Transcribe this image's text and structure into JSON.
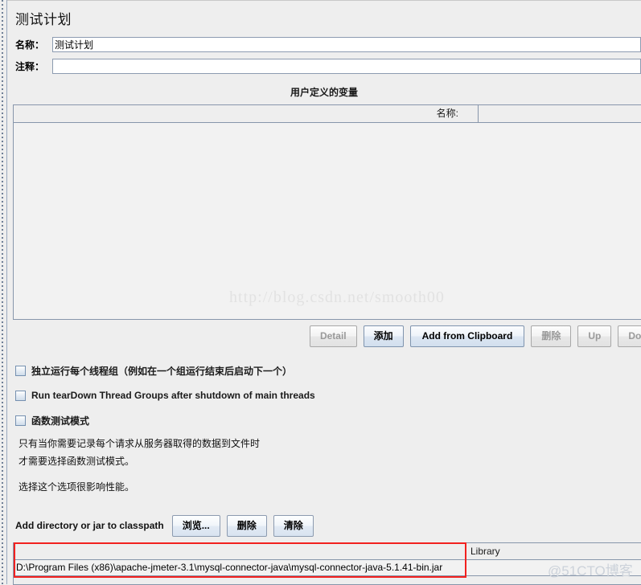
{
  "window": {
    "title": "测试计划"
  },
  "fields": {
    "name_label": "名称：",
    "name_value": "测试计划",
    "comment_label": "注释：",
    "comment_value": ""
  },
  "user_defined_variables": {
    "caption": "用户定义的变量",
    "columns": [
      "名称:",
      ""
    ],
    "rows": [],
    "buttons": [
      {
        "label": "Detail",
        "enabled": false
      },
      {
        "label": "添加",
        "enabled": true
      },
      {
        "label": "Add from Clipboard",
        "enabled": true
      },
      {
        "label": "删除",
        "enabled": false
      },
      {
        "label": "Up",
        "enabled": false
      },
      {
        "label": "Down",
        "enabled": false
      }
    ]
  },
  "options": [
    {
      "label": "独立运行每个线程组（例如在一个组运行结束后启动下一个）",
      "checked": false
    },
    {
      "label": "Run tearDown Thread Groups after shutdown of main threads",
      "checked": false
    },
    {
      "label": "函数测试模式",
      "checked": false
    }
  ],
  "description": {
    "line1": "只有当你需要记录每个请求从服务器取得的数据到文件时",
    "line2": "才需要选择函数测试模式。",
    "line3": "选择这个选项很影响性能。"
  },
  "classpath": {
    "label": "Add directory or jar to classpath",
    "buttons": [
      {
        "label": "浏览...",
        "name": "browse"
      },
      {
        "label": "删除",
        "name": "delete"
      },
      {
        "label": "清除",
        "name": "clear"
      }
    ],
    "columns": [
      "",
      "Library"
    ],
    "rows": [
      {
        "path": "D:\\Program Files (x86)\\apache-jmeter-3.1\\mysql-connector-java\\mysql-connector-java-5.1.41-bin.jar",
        "library": ""
      }
    ]
  },
  "watermarks": {
    "center": "http://blog.csdn.net/smooth00",
    "bottom_right": "@51CTO博客"
  },
  "colors": {
    "background": "#eeeeee",
    "panel_border": "#8796ab",
    "annotation_red": "#f2211f",
    "enabled_button": "#d2dfee",
    "disabled_text": "#9a9a9a",
    "watermark": "#e2e2e2"
  }
}
